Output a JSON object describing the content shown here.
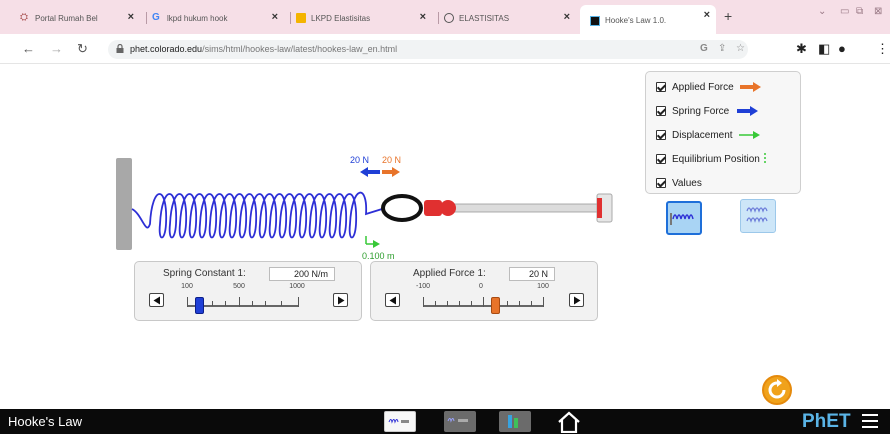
{
  "browser": {
    "tabs": [
      {
        "title": "Portal Rumah Bel",
        "icon": "portal-icon"
      },
      {
        "title": "lkpd hukum hook",
        "icon": "google-icon"
      },
      {
        "title": "LKPD Elastisitas",
        "icon": "docs-icon"
      },
      {
        "title": "ELASTISITAS",
        "icon": "globe-icon"
      },
      {
        "title": "Hooke's Law 1.0.",
        "icon": "phet-tab-icon"
      }
    ],
    "url_domain": "phet.colorado.edu",
    "url_path": "/sims/html/hookes-law/latest/hookes-law_en.html"
  },
  "sim": {
    "applied_force_label": "20 N",
    "spring_force_label": "20 N",
    "displacement_label": "0.100 m",
    "spring_constant": {
      "title": "Spring Constant 1:",
      "value": "200 N/m",
      "ticks": [
        "100",
        "500",
        "1000"
      ],
      "level_fraction": 0.111
    },
    "applied_force": {
      "title": "Applied Force 1:",
      "value": "20 N",
      "ticks": [
        "-100",
        "0",
        "100"
      ],
      "level_fraction": 0.6
    },
    "checkboxes": [
      {
        "label": "Applied Force",
        "checked": true,
        "arrow_color": "#e8742a"
      },
      {
        "label": "Spring Force",
        "checked": true,
        "arrow_color": "#1f3fd6"
      },
      {
        "label": "Displacement",
        "checked": true,
        "arrow_color": "#37c837"
      },
      {
        "label": "Equilibrium Position",
        "checked": true,
        "arrow_color": "#37c837"
      },
      {
        "label": "Values",
        "checked": true
      }
    ]
  },
  "navbar": {
    "title": "Hooke's Law",
    "logo": "PhET"
  },
  "colors": {
    "applied": "#e8742a",
    "spring": "#1f3fd6",
    "displacement": "#37c837",
    "accent_blue": "#5ab4e6"
  }
}
